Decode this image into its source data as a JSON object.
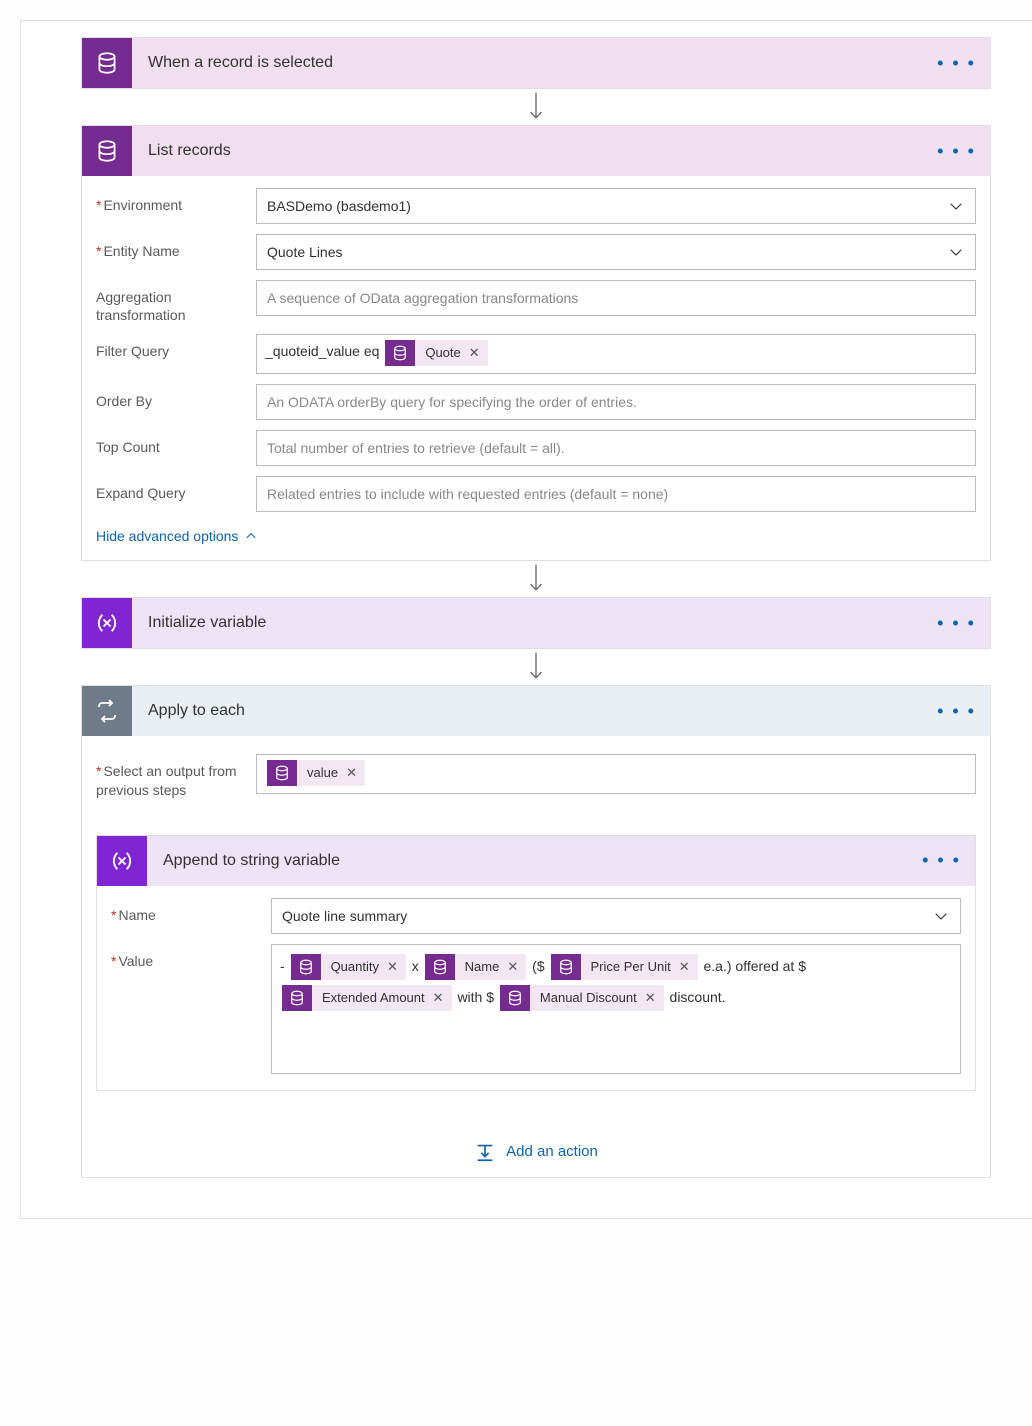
{
  "trigger": {
    "title": "When a record is selected"
  },
  "list_records": {
    "title": "List records",
    "fields": {
      "environment_label": "Environment",
      "environment_value": "BASDemo (basdemo1)",
      "entity_label": "Entity Name",
      "entity_value": "Quote Lines",
      "agg_label": "Aggregation transformation",
      "agg_placeholder": "A sequence of OData aggregation transformations",
      "filter_label": "Filter Query",
      "filter_prefix": "_quoteid_value eq",
      "filter_token": "Quote",
      "orderby_label": "Order By",
      "orderby_placeholder": "An ODATA orderBy query for specifying the order of entries.",
      "top_label": "Top Count",
      "top_placeholder": "Total number of entries to retrieve (default = all).",
      "expand_label": "Expand Query",
      "expand_placeholder": "Related entries to include with requested entries (default = none)"
    },
    "hide_adv": "Hide advanced options"
  },
  "init_var": {
    "title": "Initialize variable"
  },
  "apply_each": {
    "title": "Apply to each",
    "select_label": "Select an output from previous steps",
    "select_token": "value"
  },
  "append_str": {
    "title": "Append to string variable",
    "name_label": "Name",
    "name_value": "Quote line summary",
    "value_label": "Value",
    "value_parts": {
      "p1": "- ",
      "p2": " x ",
      "p3": " ($",
      "p4": " e.a.) offered at $",
      "p5": " with $",
      "p6": " discount.",
      "tk_qty": "Quantity",
      "tk_name": "Name",
      "tk_ppu": "Price Per Unit",
      "tk_ext": "Extended Amount",
      "tk_md": "Manual Discount"
    }
  },
  "add_action": "Add an action"
}
